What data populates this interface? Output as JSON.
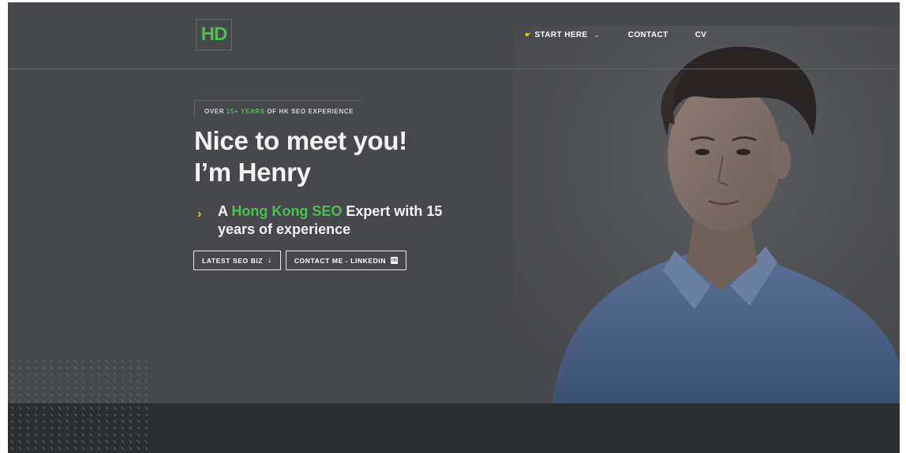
{
  "logo": {
    "text": "HD"
  },
  "nav": {
    "start_here": "START HERE",
    "contact": "CONTACT",
    "cv": "CV"
  },
  "hero": {
    "eyebrow_pre": "OVER ",
    "eyebrow_accent": "15+ YEARS",
    "eyebrow_post": " OF HK SEO EXPERIENCE",
    "headline_line1": "Nice to meet you!",
    "headline_line2": "I’m Henry",
    "sub_pre": "A ",
    "sub_accent": "Hong Kong SEO",
    "sub_post_line1": " Expert with 15",
    "sub_line2": "years of experience"
  },
  "buttons": {
    "latest": "LATEST SEO BIZ",
    "latest_icon": "↓",
    "contact_linkedin": "CONTACT ME - LINKEDIN",
    "linkedin_icon_glyph": "in"
  },
  "colors": {
    "accent_green": "#49c150",
    "accent_yellow": "#f1c40f",
    "hero_bg": "#47484b",
    "band_bg": "#2c2d30"
  },
  "icons": [
    "pointing-hand-icon",
    "chevron-down-icon",
    "chevron-right-icon",
    "arrow-down-icon",
    "linkedin-icon"
  ]
}
